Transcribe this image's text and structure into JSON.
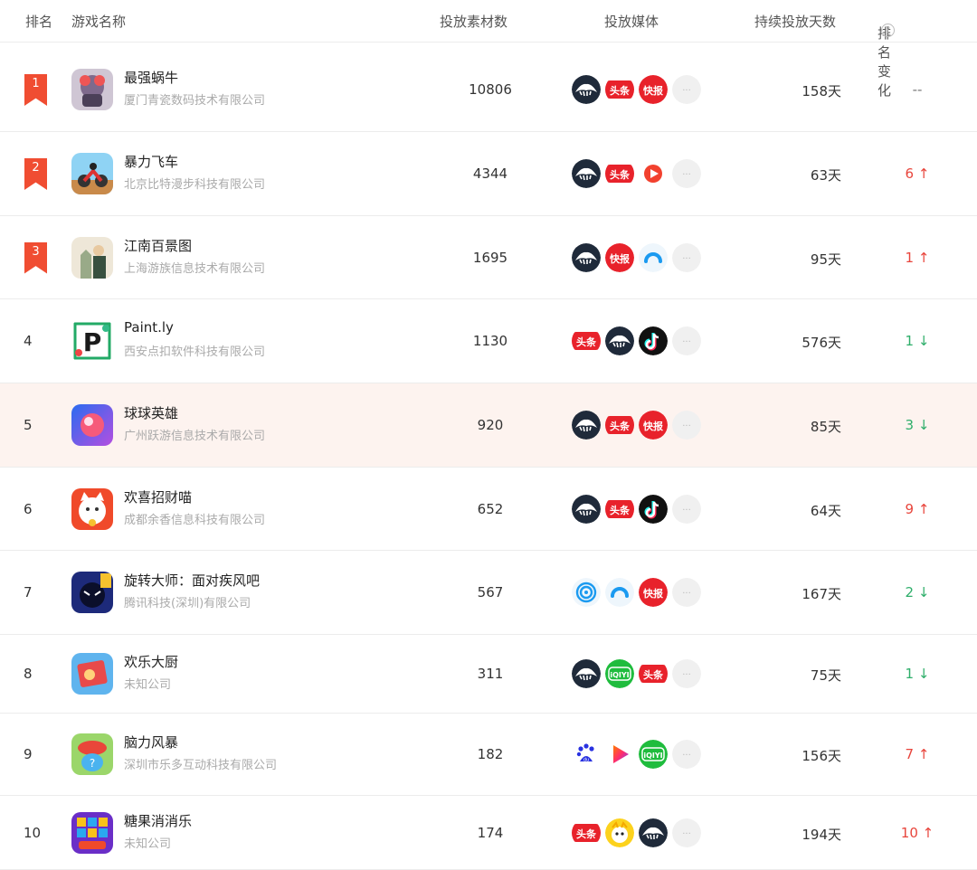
{
  "header": {
    "rank": "排名",
    "name": "游戏名称",
    "materials": "投放素材数",
    "media": "投放媒体",
    "days": "持续投放天数",
    "change": "排名变化",
    "help_glyph": "?"
  },
  "rows": [
    {
      "rank": "1",
      "name": "最强蜗牛",
      "company": "厦门青瓷数码技术有限公司",
      "materials": "10806",
      "days": "158天",
      "change": "--",
      "direction": "none",
      "media": [
        "eagle",
        "toutiao",
        "kuaishou",
        "more"
      ]
    },
    {
      "rank": "2",
      "name": "暴力飞车",
      "company": "北京比特漫步科技有限公司",
      "materials": "4344",
      "days": "63天",
      "change": "6 ↑",
      "direction": "up",
      "media": [
        "eagle",
        "toutiao",
        "red-play",
        "more"
      ]
    },
    {
      "rank": "3",
      "name": "江南百景图",
      "company": "上海游族信息技术有限公司",
      "materials": "1695",
      "days": "95天",
      "change": "1 ↑",
      "direction": "up",
      "media": [
        "eagle",
        "kuaishou",
        "arc",
        "more"
      ]
    },
    {
      "rank": "4",
      "name": "Paint.ly",
      "company": "西安点扣软件科技有限公司",
      "materials": "1130",
      "days": "576天",
      "change": "1 ↓",
      "direction": "down",
      "media": [
        "toutiao",
        "eagle",
        "douyin",
        "more"
      ]
    },
    {
      "rank": "5",
      "name": "球球英雄",
      "company": "广州跃游信息技术有限公司",
      "materials": "920",
      "days": "85天",
      "change": "3 ↓",
      "direction": "down",
      "media": [
        "eagle",
        "toutiao",
        "kuaishou",
        "more"
      ]
    },
    {
      "rank": "6",
      "name": "欢喜招财喵",
      "company": "成都余香信息科技有限公司",
      "materials": "652",
      "days": "64天",
      "change": "9 ↑",
      "direction": "up",
      "media": [
        "eagle",
        "toutiao",
        "douyin",
        "more"
      ]
    },
    {
      "rank": "7",
      "name": "旋转大师：面对疾风吧",
      "company": "腾讯科技(深圳)有限公司",
      "materials": "567",
      "days": "167天",
      "change": "2 ↓",
      "direction": "down",
      "media": [
        "tencent",
        "arc",
        "kuaishou",
        "more"
      ]
    },
    {
      "rank": "8",
      "name": "欢乐大厨",
      "company": "未知公司",
      "materials": "311",
      "days": "75天",
      "change": "1 ↓",
      "direction": "down",
      "media": [
        "eagle",
        "iqiyi",
        "toutiao",
        "more"
      ]
    },
    {
      "rank": "9",
      "name": "脑力风暴",
      "company": "深圳市乐多互动科技有限公司",
      "materials": "182",
      "days": "156天",
      "change": "7 ↑",
      "direction": "up",
      "media": [
        "baidu",
        "play",
        "iqiyi",
        "more"
      ]
    },
    {
      "rank": "10",
      "name": "糖果消消乐",
      "company": "未知公司",
      "materials": "174",
      "days": "194天",
      "change": "10 ↑",
      "direction": "up",
      "media": [
        "toutiao",
        "yellow",
        "eagle",
        "more"
      ]
    }
  ],
  "media_labels": {
    "toutiao": "头条",
    "kuaishou": "快报",
    "iqiyi": "iQIYI",
    "baidu": "du",
    "more": "···"
  },
  "colors": {
    "ribbon": "#f04d32",
    "up": "#e8453c",
    "down": "#2eae6a",
    "highlight_row": "#fdf3ef",
    "eagle_bg": "#1f2a3a"
  },
  "icons": [
    "snail-game-icon",
    "motorbike-game-icon",
    "jiangnan-game-icon",
    "paintly-game-icon",
    "ball-hero-game-icon",
    "lucky-cat-game-icon",
    "spin-master-game-icon",
    "happy-chef-game-icon",
    "brain-storm-game-icon",
    "candy-game-icon"
  ]
}
